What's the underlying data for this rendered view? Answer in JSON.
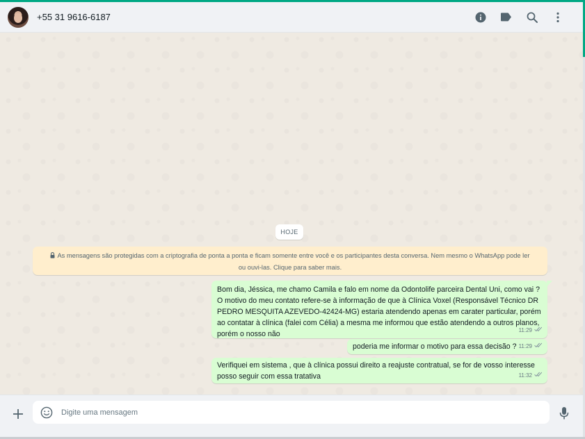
{
  "header": {
    "contact_name": "+55 31 9616-6187",
    "icons": [
      "info-icon",
      "label-icon",
      "search-icon",
      "menu-icon"
    ]
  },
  "chat": {
    "date_label": "HOJE",
    "encryption_notice": "As mensagens são protegidas com a criptografia de ponta a ponta e ficam somente entre você e os participantes desta conversa. Nem mesmo o WhatsApp pode ler ou ouvi-las. Clique para saber mais.",
    "messages": [
      {
        "text": "Bom dia, Jéssica, me chamo Camila e falo em nome da Odontolife parceira Dental Uni, como vai ? O motivo do meu contato refere-se à informação de que à Clínica Voxel (Responsável Técnico DR PEDRO MESQUITA AZEVEDO-42424-MG) estaria atendendo apenas em carater particular, porém ao contatar à clínica (falei com Célia) a mesma me informou que estão atendendo a outros planos, porém o nosso não",
        "time": "11:29",
        "status": "read"
      },
      {
        "text": "poderia me informar o motivo para essa decisão ?",
        "time": "11:29",
        "status": "read"
      },
      {
        "text": "Verifiquei em sistema , que à clínica possui direito a reajuste contratual, se for de vosso interesse posso seguir com essa tratativa",
        "time": "11:32",
        "status": "read"
      }
    ]
  },
  "composer": {
    "placeholder": "Digite uma mensagem",
    "value": ""
  },
  "colors": {
    "accent": "#00a884",
    "outgoing_bubble": "#d9fdd3",
    "notice_bg": "#ffeecd",
    "chat_bg": "#efeae2",
    "panel_bg": "#f0f2f5",
    "read_tick": "#8696a0"
  }
}
